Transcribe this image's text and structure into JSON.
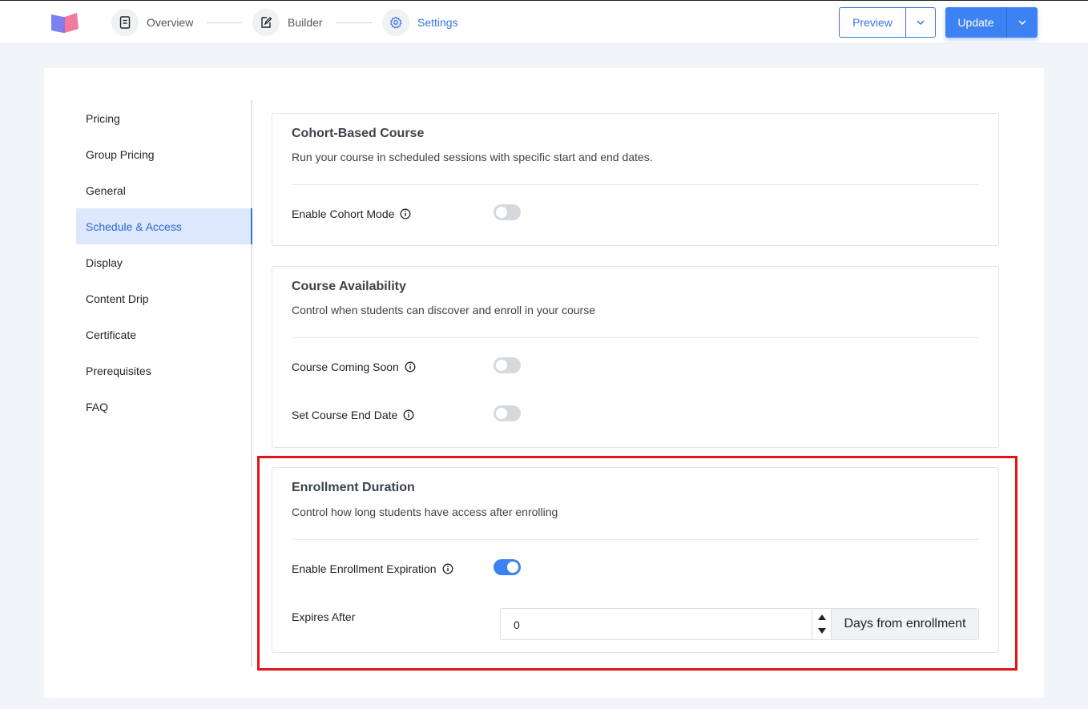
{
  "header": {
    "steps": [
      {
        "label": "Overview",
        "icon": "document-icon"
      },
      {
        "label": "Builder",
        "icon": "edit-icon"
      },
      {
        "label": "Settings",
        "icon": "gear-icon"
      }
    ],
    "preview_label": "Preview",
    "update_label": "Update",
    "colors": {
      "accent": "#3d82f2",
      "active_text": "#3874e8"
    }
  },
  "sidebar": {
    "items": [
      {
        "label": "Pricing"
      },
      {
        "label": "Group Pricing"
      },
      {
        "label": "General"
      },
      {
        "label": "Schedule & Access",
        "active": true
      },
      {
        "label": "Display"
      },
      {
        "label": "Content Drip"
      },
      {
        "label": "Certificate"
      },
      {
        "label": "Prerequisites"
      },
      {
        "label": "FAQ"
      }
    ]
  },
  "cohort": {
    "title": "Cohort-Based Course",
    "description": "Run your course in scheduled sessions with specific start and end dates.",
    "enable_label": "Enable Cohort Mode",
    "enabled": false
  },
  "availability": {
    "title": "Course Availability",
    "description": "Control when students can discover and enroll in your course",
    "coming_soon_label": "Course Coming Soon",
    "coming_soon_enabled": false,
    "end_date_label": "Set Course End Date",
    "end_date_enabled": false
  },
  "enrollment": {
    "title": "Enrollment Duration",
    "description": "Control how long students have access after enrolling",
    "expiration_label": "Enable Enrollment Expiration",
    "expiration_enabled": true,
    "expires_after_label": "Expires After",
    "expires_after_value": "0",
    "unit_label": "Days from enrollment"
  },
  "annotation": {
    "highlight_color": "#e01515"
  }
}
